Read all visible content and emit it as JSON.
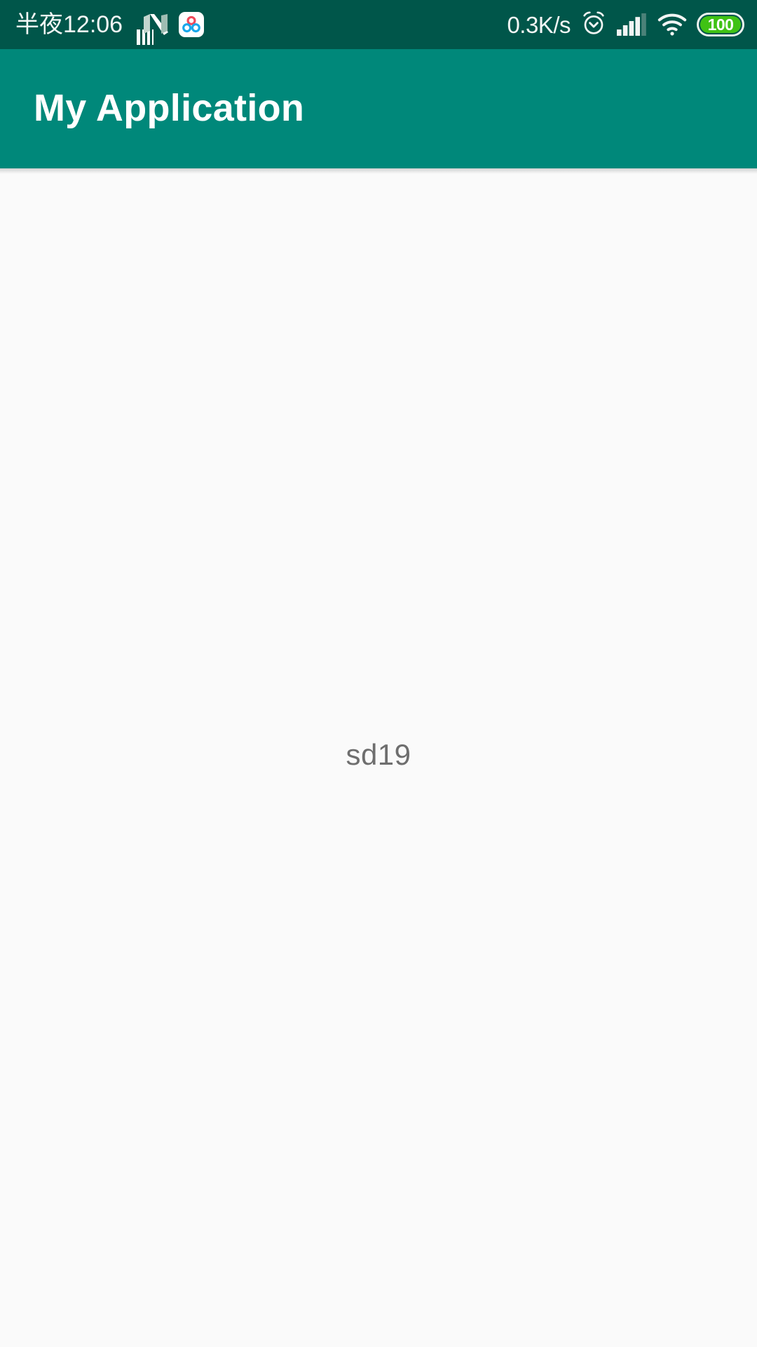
{
  "status_bar": {
    "background_color": "#00564a",
    "clock": "半夜12:06",
    "network_speed": "0.3K/s",
    "notification_icons": [
      {
        "name": "blue-square-app-icon",
        "label": ""
      },
      {
        "name": "n-ribbon-app-icon",
        "label": ""
      },
      {
        "name": "netdisk-app-icon",
        "label": ""
      }
    ],
    "system_icons": [
      {
        "name": "alarm-clock-icon"
      },
      {
        "name": "cellular-signal-icon",
        "bars_filled": 4,
        "bars_total": 5
      },
      {
        "name": "wifi-icon"
      }
    ],
    "battery": {
      "level_text": "100",
      "fill_color": "#3fc214",
      "text_color": "#ffffff"
    }
  },
  "app_bar": {
    "title": "My Application",
    "background_color": "#00887a",
    "title_color": "#ffffff"
  },
  "content": {
    "background_color": "#fafafa",
    "center_text": "sd19",
    "center_text_color": "#6e6e6e"
  }
}
